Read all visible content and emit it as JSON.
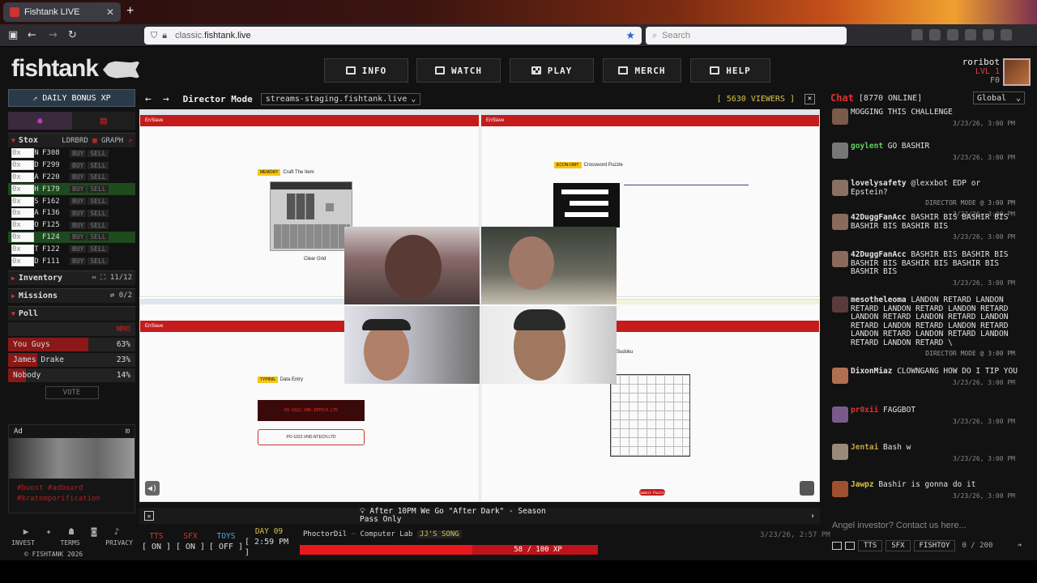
{
  "browser": {
    "tab_title": "Fishtank LIVE",
    "tab_close": "✕",
    "new_tab": "+",
    "url_prefix": "classic.",
    "url_domain": "fishtank.live",
    "search_placeholder": "Search"
  },
  "header": {
    "logo": "fishtank",
    "nav": [
      {
        "label": "INFO",
        "icon": "info-icon"
      },
      {
        "label": "WATCH",
        "icon": "camera-icon"
      },
      {
        "label": "PLAY",
        "icon": "checkerboard-icon"
      },
      {
        "label": "MERCH",
        "icon": "cart-icon"
      },
      {
        "label": "HELP",
        "icon": "help-icon"
      }
    ],
    "user": {
      "name": "roribot",
      "level": "LVL 1",
      "coins": "F0"
    }
  },
  "sidebar": {
    "daily_bonus": "DAILY BONUS XP",
    "stox": {
      "title": "Stox",
      "ldrbrd": "LDRBRD",
      "graph": "GRAPH",
      "items": [
        {
          "ticker": "TWIN",
          "price": "F308",
          "qty": "0x",
          "buy": "BUY",
          "sell": "SELL",
          "hl": false
        },
        {
          "ticker": "LAND",
          "price": "F299",
          "qty": "0x",
          "buy": "BUY",
          "sell": "SELL",
          "hl": false
        },
        {
          "ticker": "JDRA",
          "price": "F220",
          "qty": "0x",
          "buy": "BUY",
          "sell": "SELL",
          "hl": false
        },
        {
          "ticker": "BASH",
          "price": "F179",
          "qty": "0x",
          "buy": "BUY",
          "sell": "SELL",
          "hl": true
        },
        {
          "ticker": "ANIS",
          "price": "F162",
          "qty": "0x",
          "buy": "BUY",
          "sell": "SELL",
          "hl": false
        },
        {
          "ticker": "EMMA",
          "price": "F136",
          "qty": "0x",
          "buy": "BUY",
          "sell": "SELL",
          "hl": false
        },
        {
          "ticker": "ROBO",
          "price": "F125",
          "qty": "0x",
          "buy": "BUY",
          "sell": "SELL",
          "hl": false
        },
        {
          "ticker": "JD",
          "price": "F124",
          "qty": "0x",
          "buy": "BUY",
          "sell": "SELL",
          "hl": true
        },
        {
          "ticker": "VICT",
          "price": "F122",
          "qty": "0x",
          "buy": "BUY",
          "sell": "SELL",
          "hl": false
        },
        {
          "ticker": "HEAD",
          "price": "F111",
          "qty": "0x",
          "buy": "BUY",
          "sell": "SELL",
          "hl": false
        }
      ]
    },
    "inventory": {
      "title": "Inventory",
      "count": "11/12"
    },
    "missions": {
      "title": "Missions",
      "count": "0/2"
    },
    "poll": {
      "title": "Poll",
      "question": "WHO",
      "options": [
        {
          "label": "You Guys",
          "pct": "63%",
          "value": 0.63
        },
        {
          "label": "James Drake",
          "pct": "23%",
          "value": 0.23
        },
        {
          "label": "Nobody",
          "pct": "14%",
          "value": 0.14
        }
      ],
      "vote": "VOTE"
    },
    "ad": {
      "title": "Ad",
      "tags": [
        "#buost #adboard",
        "#kratomporification"
      ]
    },
    "footer_links": [
      "INVEST",
      "TERMS",
      "PRIVACY"
    ],
    "copyright": "© FISHTANK 2026"
  },
  "director": {
    "title": "Director Mode",
    "stream": "streams-staging.fishtank.live",
    "viewers": "[ 5630 VIEWERS ]",
    "close": "✕"
  },
  "stage": {
    "tl": {
      "app": "EnSlave",
      "badge": "MEMORY",
      "title": "Craft The Item",
      "action": "Clear Grid"
    },
    "tr": {
      "app": "EnSlave",
      "badge": "ECON-OMY",
      "title": "Crossword Puzzle"
    },
    "bl": {
      "app": "EnSlave",
      "badge": "TYPING",
      "title": "Data Entry",
      "code": "PO-1022.VND.INTECH.LTD",
      "input": "PO-1022.VND.NTECH.LTD"
    },
    "br": {
      "title": "Sudoku",
      "btn": "Submit Puzzle"
    }
  },
  "ticker": {
    "message": "After 10PM We Go \"After Dark\" - Season Pass Only"
  },
  "controls": {
    "tts": {
      "label": "TTS",
      "value": "[ ON ]"
    },
    "sfx": {
      "label": "SFX",
      "value": "[ ON ]"
    },
    "toys": {
      "label": "TOYS",
      "value": "[ OFF ]"
    },
    "day": {
      "label": "DAY 09",
      "value": "[ 2:59 PM ]"
    },
    "cam_user": "PhoctorDil",
    "room": "Computer Lab",
    "song": "JJ'S SONG",
    "timestamp": "3/23/26, 2:57 PM",
    "xp": "58 / 100 XP",
    "xp_value": 0.58
  },
  "chat": {
    "title": "Chat",
    "online": "[8770 ONLINE]",
    "channel": "Global",
    "input_placeholder": "Angel investor? Contact us here...",
    "buttons": [
      "TTS",
      "SFX",
      "FISHTOY"
    ],
    "char_count": "0 / 200",
    "messages": [
      {
        "name": "",
        "text": "MOGGING THIS CHALLENGE",
        "time": "3/23/26, 3:00 PM",
        "color": "#e4e4e4",
        "avatar": "#7a5a4a",
        "note": ""
      },
      {
        "name": "goylent",
        "text": " GO BASHIR",
        "time": "3/23/26, 3:00 PM",
        "color": "#5fd35f",
        "avatar": "#777",
        "note": ""
      },
      {
        "name": "lovelysafety",
        "text": " @lexxbot EDP or Epstein?",
        "time": "3/23/26, 3:00 PM",
        "color": "#e4e4e4",
        "avatar": "#8a7060",
        "note": "DIRECTOR MODE @ 3:00 PM"
      },
      {
        "name": "42DuggFanAcc",
        "text": " BASHIR BIS BASHIR BIS BASHIR BIS BASHIR BIS",
        "time": "3/23/26, 3:00 PM",
        "color": "#e4e4e4",
        "avatar": "#8a6a5a",
        "note": ""
      },
      {
        "name": "42DuggFanAcc",
        "text": " BASHIR BIS BASHIR BIS BASHIR BIS BASHIR BIS BASHIR BIS BASHIR BIS",
        "time": "3/23/26, 3:00 PM",
        "color": "#e4e4e4",
        "avatar": "#8a6a5a",
        "note": ""
      },
      {
        "name": "mesotheleoma",
        "text": " LANDON RETARD LANDON RETARD LANDON RETARD LANDON RETARD LANDON RETARD LANDON RETARD LANDON RETARD LANDON RETARD LANDON RETARD LANDON RETARD LANDON RETARD LANDON RETARD LANDON RETARD \\",
        "time": "",
        "color": "#e4e4e4",
        "avatar": "#5a3a3a",
        "note": "DIRECTOR MODE @ 3:00 PM"
      },
      {
        "name": "DixonMiaz",
        "text": " CLOWNGANG HOW DO I TIP YOU",
        "time": "3/23/26, 3:00 PM",
        "color": "#e4e4e4",
        "avatar": "#b07050",
        "note": ""
      },
      {
        "name": "pr0xii",
        "text": " FAGGBOT",
        "time": "3/23/26, 3:00 PM",
        "color": "#e03030",
        "avatar": "#7a5a8a",
        "note": ""
      },
      {
        "name": "Jentai",
        "text": " Bash w",
        "time": "3/23/26, 3:00 PM",
        "color": "#c8a040",
        "avatar": "#9a8a7a",
        "note": ""
      },
      {
        "name": "Jawpz",
        "text": " Bashir is gonna do it",
        "time": "3/23/26, 3:00 PM",
        "color": "#d8c24a",
        "avatar": "#a05030",
        "note": ""
      }
    ]
  }
}
